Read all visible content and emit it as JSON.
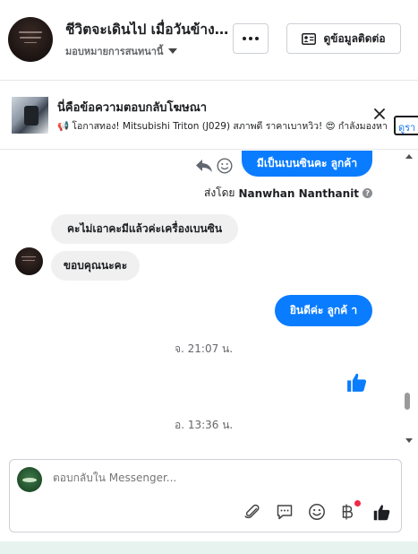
{
  "header": {
    "title": "ชีวิตจะเดินไป เมื่อวันข้างหน้า",
    "assignee": "มอบหมายการสนทนานี้",
    "more_label": "More options",
    "contact_button": "ดูข้อมูลติดต่อ"
  },
  "ad_banner": {
    "title": "นี่คือข้อความตอบกลับโฆษณา",
    "text": "📢 โอกาสทอง! Mitsubishi Triton (J029) สภาพดี ราคาเบาหวิว! 😍 กำลังมองหา",
    "peek_text": "ดูรา"
  },
  "messages": [
    {
      "direction": "out",
      "text": "มีเป็นเบนซินคะ ลูกค้า"
    },
    {
      "direction": "in",
      "text": "คะไม่เอาคะมีแล้วค่ะเครื่องเบนซิน"
    },
    {
      "direction": "in",
      "text": "ขอบคุณนะคะ"
    },
    {
      "direction": "out",
      "text": "ยินดีค่ะ  ลูกค้ า"
    }
  ],
  "sent_by": {
    "prefix": "ส่งโดย",
    "name": "Nanwhan Nanthanit",
    "info": "?"
  },
  "timestamps": [
    "จ. 21:07 น.",
    "อ. 13:36 น."
  ],
  "composer": {
    "placeholder": "ตอบกลับใน Messenger..."
  },
  "colors": {
    "accent": "#0a7cff",
    "incoming_bubble": "#f0f0f0",
    "notification_dot": "#f02849"
  },
  "icons": [
    "reply-icon",
    "emoji-reaction-icon",
    "close-icon",
    "attach-icon",
    "saved-replies-icon",
    "emoji-icon",
    "baht-payment-icon",
    "like-icon"
  ]
}
